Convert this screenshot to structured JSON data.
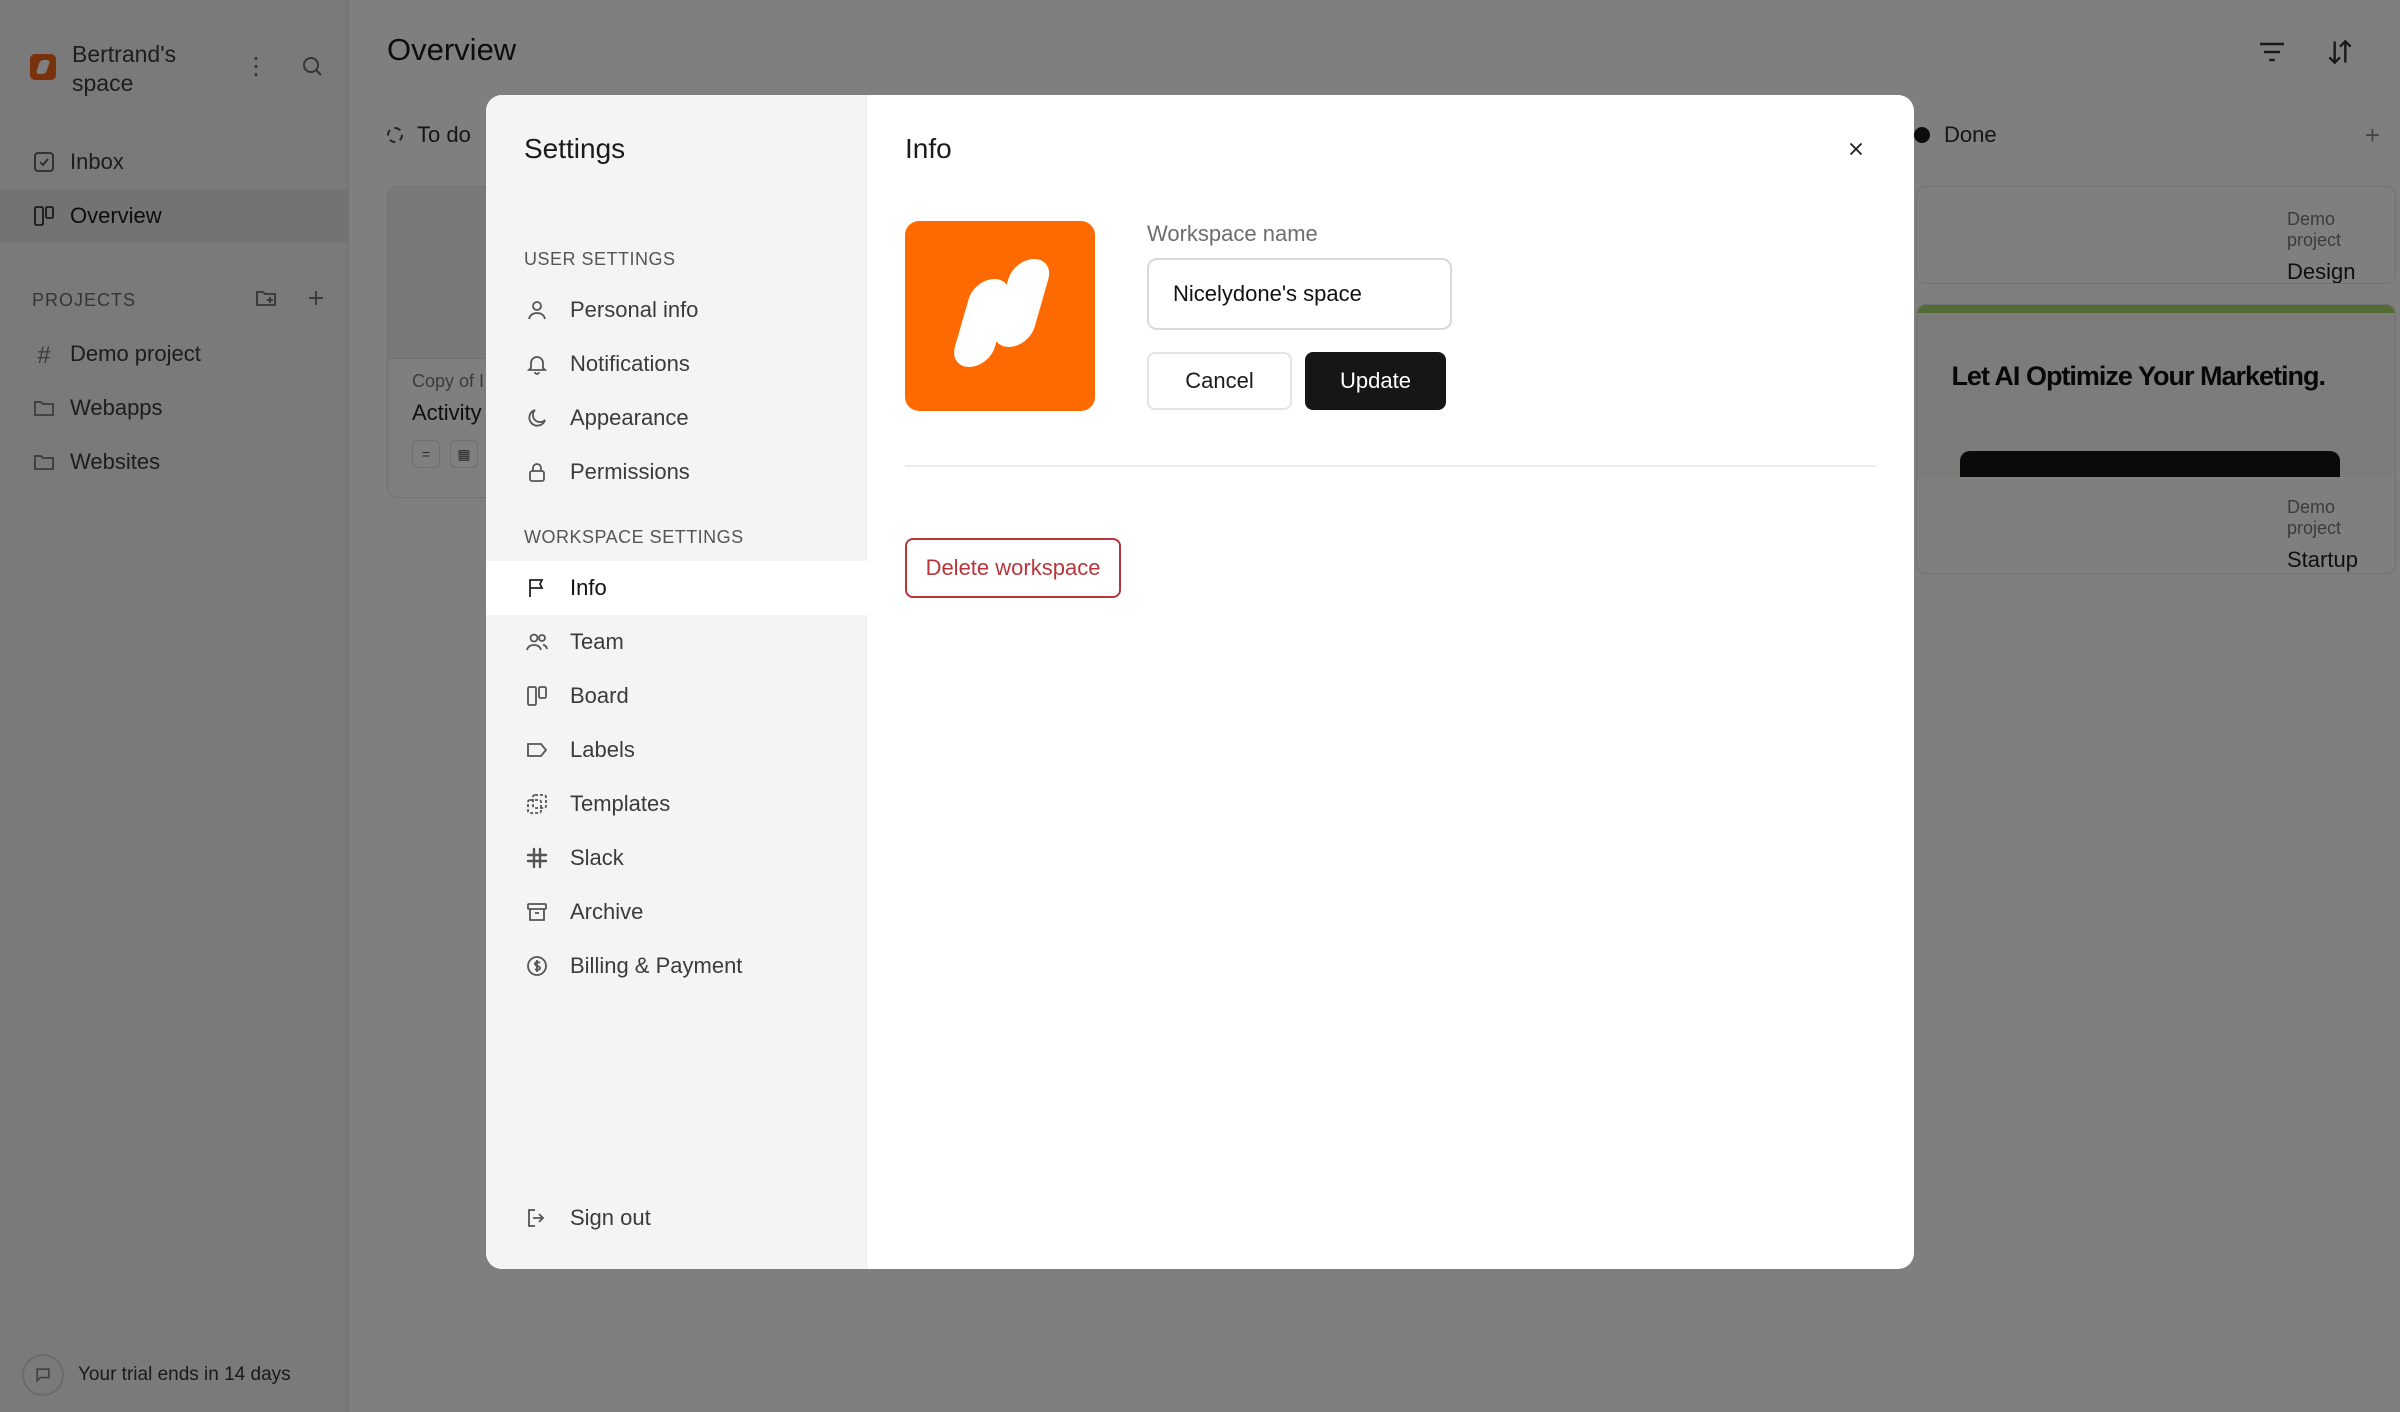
{
  "app": {
    "workspace_name": "Bertrand's space",
    "nav": [
      {
        "label": "Inbox",
        "icon": "inbox-icon"
      },
      {
        "label": "Overview",
        "icon": "board-icon",
        "active": true
      }
    ],
    "projects_label": "PROJECTS",
    "projects": [
      {
        "label": "Demo project",
        "icon": "hash-icon"
      },
      {
        "label": "Webapps",
        "icon": "folder-icon"
      },
      {
        "label": "Websites",
        "icon": "folder-icon"
      }
    ],
    "trial_text": "Your trial ends in 14 days",
    "page_title": "Overview",
    "columns": [
      {
        "label": "To do",
        "status": "todo"
      },
      {
        "label": "Done",
        "status": "done"
      }
    ],
    "cards": {
      "todo_card": {
        "project": "Copy of I",
        "title": "Activity"
      },
      "done_card_1": {
        "project": "Demo project",
        "title": "Design email newsletter template"
      },
      "done_card_2": {
        "project": "Demo project",
        "title": "Startup landing page update",
        "thumb_text": "Let AI Optimize Your Marketing."
      }
    }
  },
  "modal": {
    "title": "Settings",
    "user_section": "USER SETTINGS",
    "user_items": [
      {
        "label": "Personal info",
        "icon": "person-icon"
      },
      {
        "label": "Notifications",
        "icon": "bell-icon"
      },
      {
        "label": "Appearance",
        "icon": "moon-icon"
      },
      {
        "label": "Permissions",
        "icon": "lock-icon"
      }
    ],
    "workspace_section": "WORKSPACE SETTINGS",
    "workspace_items": [
      {
        "label": "Info",
        "icon": "flag-icon",
        "active": true
      },
      {
        "label": "Team",
        "icon": "team-icon"
      },
      {
        "label": "Board",
        "icon": "board-icon"
      },
      {
        "label": "Labels",
        "icon": "label-icon"
      },
      {
        "label": "Templates",
        "icon": "templates-icon"
      },
      {
        "label": "Slack",
        "icon": "slack-icon"
      },
      {
        "label": "Archive",
        "icon": "archive-icon"
      },
      {
        "label": "Billing & Payment",
        "icon": "dollar-icon"
      }
    ],
    "sign_out": "Sign out",
    "content": {
      "title": "Info",
      "workspace_name_label": "Workspace name",
      "workspace_name_value": "Nicelydone's space",
      "cancel_label": "Cancel",
      "update_label": "Update",
      "delete_label": "Delete workspace"
    }
  },
  "colors": {
    "brand_orange": "#ff6a00",
    "danger": "#b8363b",
    "primary_button": "#161616"
  }
}
